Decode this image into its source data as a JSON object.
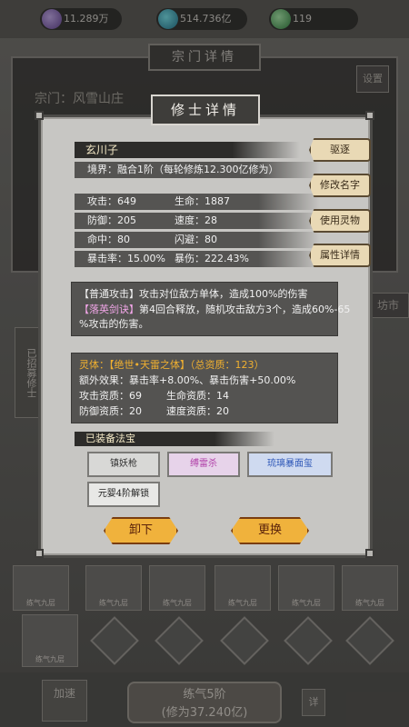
{
  "resources": [
    {
      "icon": "purple-crystal-icon",
      "value": "11.289万"
    },
    {
      "icon": "blue-flame-icon",
      "value": "514.736亿"
    },
    {
      "icon": "green-jade-icon",
      "value": "119"
    }
  ],
  "background": {
    "section_title": "宗门详情",
    "sect_name": "宗门：风雪山庄",
    "settings": "设置",
    "left_tab": "已招募修士",
    "market": "坊市",
    "card_label": "练气九层",
    "bottom_left": "加速",
    "bottom_mid_line1": "练气5阶",
    "bottom_mid_line2": "(修为37.240亿)",
    "bottom_right": "详"
  },
  "modal": {
    "title": "修士详情",
    "name": "玄川子",
    "realm": "境界：融合1阶（每轮修炼12.300亿修为）",
    "stats": [
      {
        "label1": "攻击：649",
        "label2": "生命：1887"
      },
      {
        "label1": "防御：205",
        "label2": "速度：28"
      },
      {
        "label1": "命中：80",
        "label2": "闪避：80"
      },
      {
        "label1": "暴击率：15.00%",
        "label2": "暴伤：222.43%"
      }
    ],
    "side_buttons": [
      "驱逐",
      "修改名字",
      "使用灵物",
      "属性详情"
    ],
    "skills": {
      "normal_tag": "【普通攻击】",
      "normal_text": "攻击对位敌方单体，造成100%的伤害",
      "special_tag": "【落英剑诀】",
      "special_text": "第4回合释放，随机攻击敌方3个，造成60%-65",
      "special_text2": "%攻击的伤害。"
    },
    "body": {
      "label": "灵体：",
      "name": "【绝世•天雷之体】",
      "total": "（总资质：123）",
      "extra": "额外效果：暴击率+8.00%、暴击伤害+50.00%",
      "apt1a": "攻击资质：69",
      "apt1b": "生命资质：14",
      "apt2a": "防御资质：20",
      "apt2b": "速度资质：20"
    },
    "treasure_title": "已装备法宝",
    "treasures": [
      "镇妖枪",
      "缚雷杀",
      "琉璃暴面玺",
      "元婴4阶解锁"
    ],
    "unequip": "卸下",
    "replace": "更换"
  },
  "colors": {
    "gold": "#f0b030",
    "blue": "#8fb4ff",
    "pink": "#f2a6e8",
    "button_orange": "#f0b23c"
  }
}
